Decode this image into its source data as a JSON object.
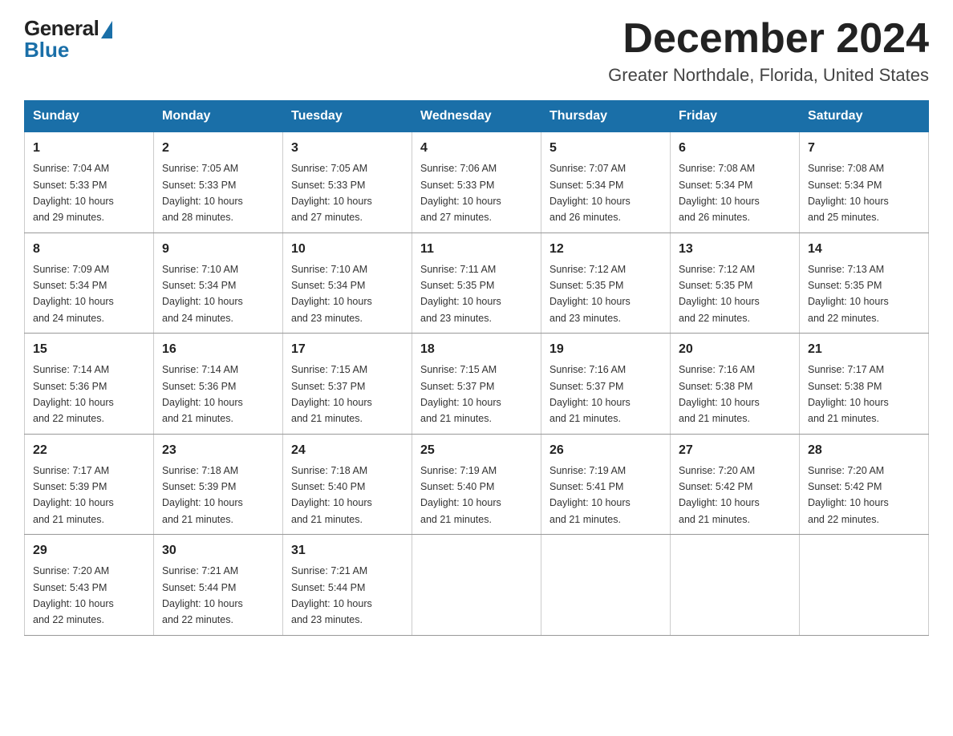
{
  "logo": {
    "general_text": "General",
    "blue_text": "Blue"
  },
  "header": {
    "title": "December 2024",
    "subtitle": "Greater Northdale, Florida, United States"
  },
  "weekdays": [
    "Sunday",
    "Monday",
    "Tuesday",
    "Wednesday",
    "Thursday",
    "Friday",
    "Saturday"
  ],
  "weeks": [
    [
      {
        "day": "1",
        "sunrise": "7:04 AM",
        "sunset": "5:33 PM",
        "daylight": "10 hours and 29 minutes."
      },
      {
        "day": "2",
        "sunrise": "7:05 AM",
        "sunset": "5:33 PM",
        "daylight": "10 hours and 28 minutes."
      },
      {
        "day": "3",
        "sunrise": "7:05 AM",
        "sunset": "5:33 PM",
        "daylight": "10 hours and 27 minutes."
      },
      {
        "day": "4",
        "sunrise": "7:06 AM",
        "sunset": "5:33 PM",
        "daylight": "10 hours and 27 minutes."
      },
      {
        "day": "5",
        "sunrise": "7:07 AM",
        "sunset": "5:34 PM",
        "daylight": "10 hours and 26 minutes."
      },
      {
        "day": "6",
        "sunrise": "7:08 AM",
        "sunset": "5:34 PM",
        "daylight": "10 hours and 26 minutes."
      },
      {
        "day": "7",
        "sunrise": "7:08 AM",
        "sunset": "5:34 PM",
        "daylight": "10 hours and 25 minutes."
      }
    ],
    [
      {
        "day": "8",
        "sunrise": "7:09 AM",
        "sunset": "5:34 PM",
        "daylight": "10 hours and 24 minutes."
      },
      {
        "day": "9",
        "sunrise": "7:10 AM",
        "sunset": "5:34 PM",
        "daylight": "10 hours and 24 minutes."
      },
      {
        "day": "10",
        "sunrise": "7:10 AM",
        "sunset": "5:34 PM",
        "daylight": "10 hours and 23 minutes."
      },
      {
        "day": "11",
        "sunrise": "7:11 AM",
        "sunset": "5:35 PM",
        "daylight": "10 hours and 23 minutes."
      },
      {
        "day": "12",
        "sunrise": "7:12 AM",
        "sunset": "5:35 PM",
        "daylight": "10 hours and 23 minutes."
      },
      {
        "day": "13",
        "sunrise": "7:12 AM",
        "sunset": "5:35 PM",
        "daylight": "10 hours and 22 minutes."
      },
      {
        "day": "14",
        "sunrise": "7:13 AM",
        "sunset": "5:35 PM",
        "daylight": "10 hours and 22 minutes."
      }
    ],
    [
      {
        "day": "15",
        "sunrise": "7:14 AM",
        "sunset": "5:36 PM",
        "daylight": "10 hours and 22 minutes."
      },
      {
        "day": "16",
        "sunrise": "7:14 AM",
        "sunset": "5:36 PM",
        "daylight": "10 hours and 21 minutes."
      },
      {
        "day": "17",
        "sunrise": "7:15 AM",
        "sunset": "5:37 PM",
        "daylight": "10 hours and 21 minutes."
      },
      {
        "day": "18",
        "sunrise": "7:15 AM",
        "sunset": "5:37 PM",
        "daylight": "10 hours and 21 minutes."
      },
      {
        "day": "19",
        "sunrise": "7:16 AM",
        "sunset": "5:37 PM",
        "daylight": "10 hours and 21 minutes."
      },
      {
        "day": "20",
        "sunrise": "7:16 AM",
        "sunset": "5:38 PM",
        "daylight": "10 hours and 21 minutes."
      },
      {
        "day": "21",
        "sunrise": "7:17 AM",
        "sunset": "5:38 PM",
        "daylight": "10 hours and 21 minutes."
      }
    ],
    [
      {
        "day": "22",
        "sunrise": "7:17 AM",
        "sunset": "5:39 PM",
        "daylight": "10 hours and 21 minutes."
      },
      {
        "day": "23",
        "sunrise": "7:18 AM",
        "sunset": "5:39 PM",
        "daylight": "10 hours and 21 minutes."
      },
      {
        "day": "24",
        "sunrise": "7:18 AM",
        "sunset": "5:40 PM",
        "daylight": "10 hours and 21 minutes."
      },
      {
        "day": "25",
        "sunrise": "7:19 AM",
        "sunset": "5:40 PM",
        "daylight": "10 hours and 21 minutes."
      },
      {
        "day": "26",
        "sunrise": "7:19 AM",
        "sunset": "5:41 PM",
        "daylight": "10 hours and 21 minutes."
      },
      {
        "day": "27",
        "sunrise": "7:20 AM",
        "sunset": "5:42 PM",
        "daylight": "10 hours and 21 minutes."
      },
      {
        "day": "28",
        "sunrise": "7:20 AM",
        "sunset": "5:42 PM",
        "daylight": "10 hours and 22 minutes."
      }
    ],
    [
      {
        "day": "29",
        "sunrise": "7:20 AM",
        "sunset": "5:43 PM",
        "daylight": "10 hours and 22 minutes."
      },
      {
        "day": "30",
        "sunrise": "7:21 AM",
        "sunset": "5:44 PM",
        "daylight": "10 hours and 22 minutes."
      },
      {
        "day": "31",
        "sunrise": "7:21 AM",
        "sunset": "5:44 PM",
        "daylight": "10 hours and 23 minutes."
      },
      null,
      null,
      null,
      null
    ]
  ],
  "labels": {
    "sunrise": "Sunrise:",
    "sunset": "Sunset:",
    "daylight": "Daylight:"
  }
}
